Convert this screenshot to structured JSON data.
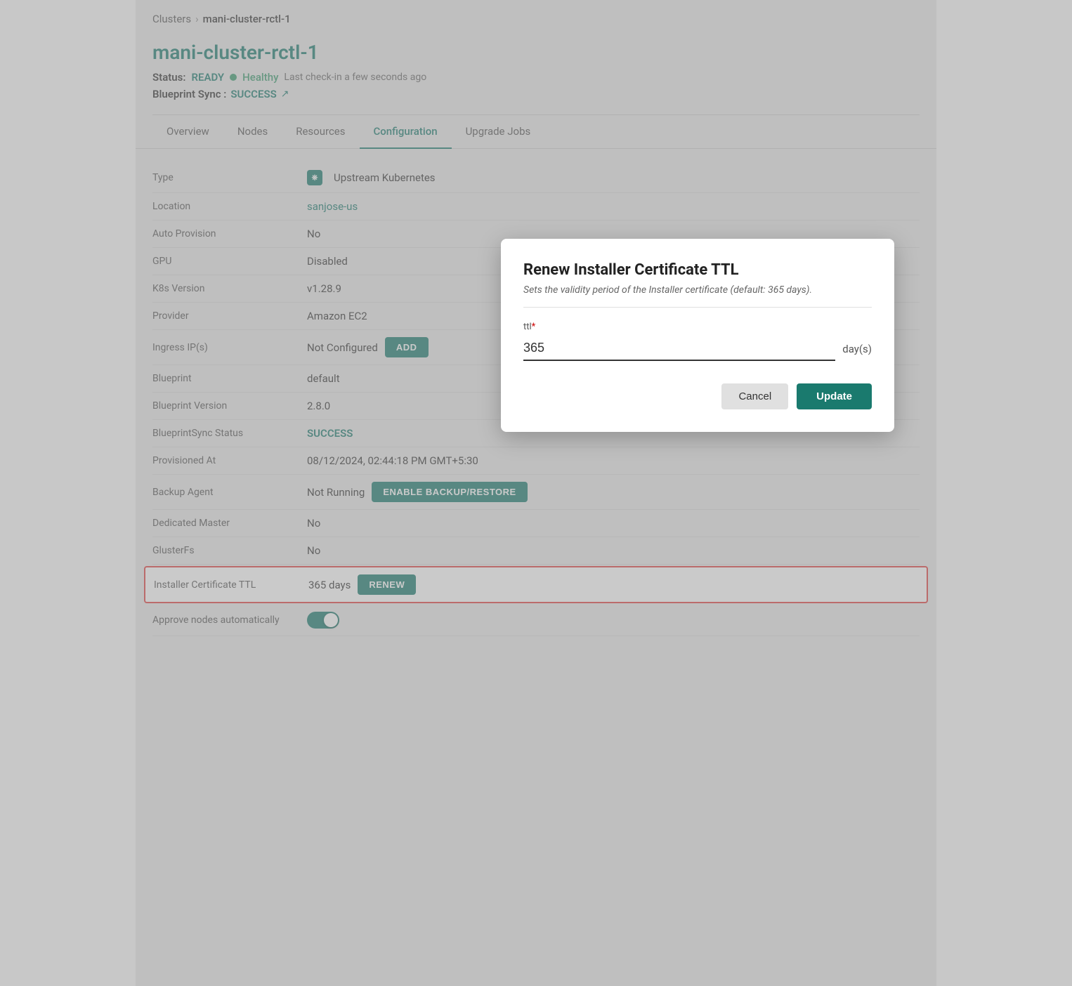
{
  "breadcrumb": {
    "parent": "Clusters",
    "separator": "›",
    "current": "mani-cluster-rctl-1"
  },
  "header": {
    "title": "mani-cluster-rctl-1",
    "status_label": "Status:",
    "status_value": "READY",
    "health_text": "Healthy",
    "last_checkin": "Last check-in a few seconds ago",
    "blueprint_label": "Blueprint Sync :",
    "blueprint_value": "SUCCESS"
  },
  "tabs": [
    {
      "label": "Overview",
      "active": false
    },
    {
      "label": "Nodes",
      "active": false
    },
    {
      "label": "Resources",
      "active": false
    },
    {
      "label": "Configuration",
      "active": true
    },
    {
      "label": "Upgrade Jobs",
      "active": false
    }
  ],
  "config": {
    "rows": [
      {
        "key": "Type",
        "value": "Upstream Kubernetes",
        "type": "k8s"
      },
      {
        "key": "Location",
        "value": "sanjose-us",
        "type": "link"
      },
      {
        "key": "Auto Provision",
        "value": "No",
        "type": "text"
      },
      {
        "key": "GPU",
        "value": "Disabled",
        "type": "text"
      },
      {
        "key": "K8s Version",
        "value": "v1.28.9",
        "type": "text"
      },
      {
        "key": "Provider",
        "value": "Amazon EC2",
        "type": "text"
      },
      {
        "key": "Ingress IP(s)",
        "value": "Not Configured",
        "type": "text",
        "button": "ADD"
      },
      {
        "key": "Blueprint",
        "value": "default",
        "type": "text"
      },
      {
        "key": "Blueprint Version",
        "value": "2.8.0",
        "type": "text"
      },
      {
        "key": "BlueprintSync Status",
        "value": "SUCCESS",
        "type": "success"
      },
      {
        "key": "Provisioned At",
        "value": "08/12/2024, 02:44:18 PM GMT+5:30",
        "type": "text"
      },
      {
        "key": "Backup Agent",
        "value": "Not Running",
        "type": "text",
        "button": "ENABLE BACKUP/RESTORE"
      },
      {
        "key": "Dedicated Master",
        "value": "No",
        "type": "text"
      },
      {
        "key": "GlusterFs",
        "value": "No",
        "type": "text"
      },
      {
        "key": "Installer Certificate TTL",
        "value": "365 days",
        "type": "text",
        "button": "RENEW",
        "highlighted": true
      },
      {
        "key": "Approve nodes automatically",
        "value": "",
        "type": "toggle"
      }
    ]
  },
  "modal": {
    "title": "Renew Installer Certificate TTL",
    "subtitle": "Sets the validity period of the Installer certificate (default: 365 days).",
    "field_label": "ttl",
    "field_required": "*",
    "field_value": "365",
    "field_unit": "day(s)",
    "cancel_label": "Cancel",
    "update_label": "Update"
  }
}
